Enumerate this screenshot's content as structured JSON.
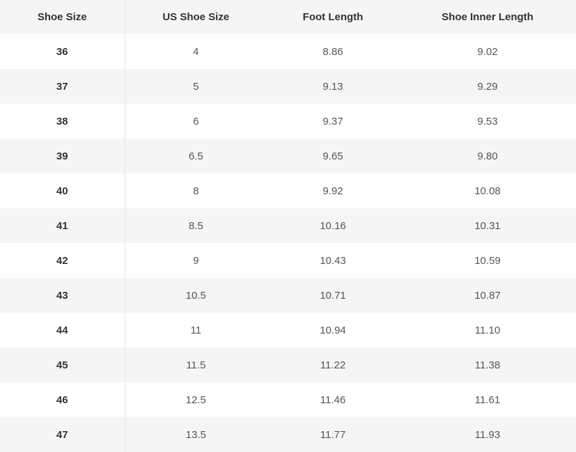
{
  "table": {
    "headers": [
      "Shoe Size",
      "US Shoe Size",
      "Foot Length",
      "Shoe Inner Length"
    ],
    "rows": [
      [
        "36",
        "4",
        "8.86",
        "9.02"
      ],
      [
        "37",
        "5",
        "9.13",
        "9.29"
      ],
      [
        "38",
        "6",
        "9.37",
        "9.53"
      ],
      [
        "39",
        "6.5",
        "9.65",
        "9.80"
      ],
      [
        "40",
        "8",
        "9.92",
        "10.08"
      ],
      [
        "41",
        "8.5",
        "10.16",
        "10.31"
      ],
      [
        "42",
        "9",
        "10.43",
        "10.59"
      ],
      [
        "43",
        "10.5",
        "10.71",
        "10.87"
      ],
      [
        "44",
        "11",
        "10.94",
        "11.10"
      ],
      [
        "45",
        "11.5",
        "11.22",
        "11.38"
      ],
      [
        "46",
        "12.5",
        "11.46",
        "11.61"
      ],
      [
        "47",
        "13.5",
        "11.77",
        "11.93"
      ]
    ]
  }
}
